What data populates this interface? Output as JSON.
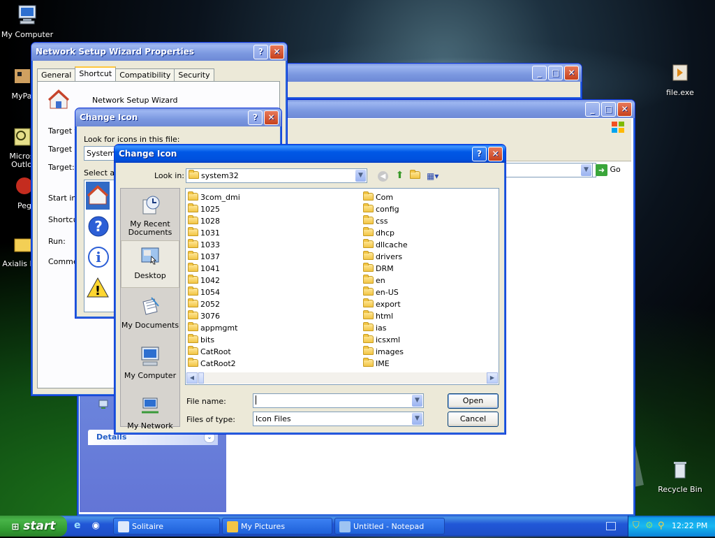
{
  "desktop": {
    "icons": {
      "my_computer": "My Computer",
      "mypa": "MyPa",
      "microsoft_outlook": "Micros\nOutlo",
      "peg": "Peg",
      "axialis": "Axialis Lib",
      "file_exe": "file.exe",
      "recycle_bin": "Recycle Bin"
    }
  },
  "props_window": {
    "title": "Network Setup Wizard Properties",
    "tabs": [
      "General",
      "Shortcut",
      "Compatibility",
      "Security"
    ],
    "shortcut_name": "Network Setup Wizard",
    "labels": {
      "target_type": "Target ty",
      "target_location": "Target lo",
      "target": "Target:",
      "start_in": "Start in:",
      "shortcut_key": "Shortcu",
      "run": "Run:",
      "comment": "Commer"
    }
  },
  "change_icon_back": {
    "title": "Change Icon",
    "look_for_label": "Look for icons in this file:",
    "file_value": "System",
    "select_label": "Select an"
  },
  "explorer_back": {
    "go_label": "Go",
    "details_label": "Details"
  },
  "dialog": {
    "title": "Change Icon",
    "look_in_label": "Look in:",
    "look_in_value": "system32",
    "places": [
      "My Recent\nDocuments",
      "Desktop",
      "My Documents",
      "My Computer",
      "My Network"
    ],
    "folders_col1": [
      "3com_dmi",
      "1025",
      "1028",
      "1031",
      "1033",
      "1037",
      "1041",
      "1042",
      "1054",
      "2052",
      "3076",
      "appmgmt",
      "bits",
      "CatRoot",
      "CatRoot2"
    ],
    "folders_col2": [
      "Com",
      "config",
      "css",
      "dhcp",
      "dllcache",
      "drivers",
      "DRM",
      "en",
      "en-US",
      "export",
      "html",
      "ias",
      "icsxml",
      "images",
      "IME"
    ],
    "file_name_label": "File name:",
    "file_name_value": "",
    "files_of_type_label": "Files of type:",
    "files_of_type_value": "Icon Files",
    "open_label": "Open",
    "cancel_label": "Cancel"
  },
  "taskbar": {
    "start_label": "start",
    "tasks": [
      "Solitaire",
      "My Pictures",
      "Untitled - Notepad"
    ],
    "clock": "12:22 PM"
  }
}
